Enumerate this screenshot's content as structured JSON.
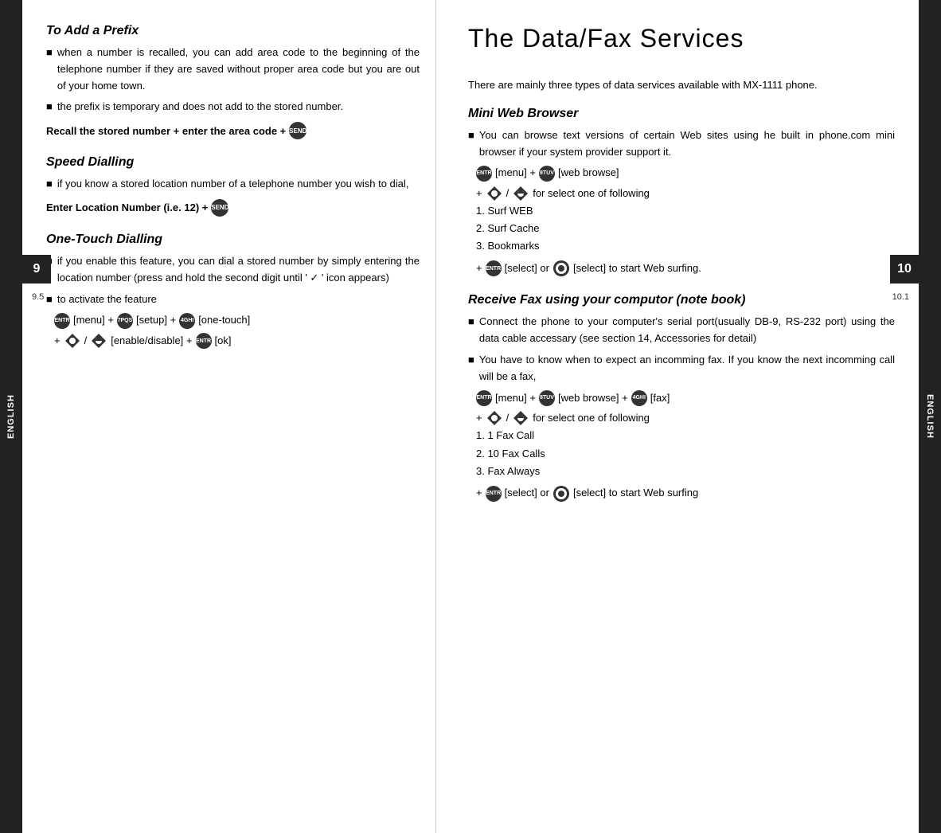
{
  "left_side_tab": "ENGLISH",
  "right_side_tab": "ENGLISH",
  "left_num_badge": "9",
  "right_num_badge": "10",
  "left_sub_badge": "9.5",
  "right_sub_badge": "10.1",
  "left_col": {
    "sections": [
      {
        "id": "add-prefix",
        "title": "To Add a Prefix",
        "bullets": [
          "when a number is recalled, you can add area code to the beginning of the telephone number if they are saved without proper area code but you are out of your home town.",
          "the prefix is temporary and does not add to the stored number."
        ],
        "instruction": "Recall the stored number + enter the area code +",
        "instruction_btn": "SEND"
      },
      {
        "id": "speed-dialling",
        "title": "Speed Dialling",
        "bullets": [
          "if you know a stored location number of a telephone number you wish to dial,"
        ],
        "instruction": "Enter Location Number (i.e. 12) +",
        "instruction_btn": "SEND"
      },
      {
        "id": "one-touch-dialling",
        "title": "One-Touch Dialling",
        "bullets": [
          "if you enable this feature, you can dial a stored number by simply entering the location number (press and hold the second digit until '✓' icon appears)",
          "to activate the feature"
        ],
        "steps": [
          {
            "text": "[menu] +",
            "btn1": "7PQS",
            "text2": "[setup] +",
            "btn2": "4GHI",
            "text3": "[one-touch]"
          },
          {
            "text": "+ ◆/▲  [enable/disable] +",
            "btn": "ENTER",
            "text2": "[ok]"
          }
        ]
      }
    ]
  },
  "right_col": {
    "page_title": "The Data/Fax Services",
    "intro": "There are mainly three types of data services available with MX-1111 phone.",
    "sections": [
      {
        "id": "mini-web-browser",
        "title": "Mini Web Browser",
        "bullets": [
          "You can browse text versions of certain Web sites using he built in phone.com mini browser if your system provider support it."
        ],
        "steps": [
          {
            "btn": "ENTER",
            "text": "[menu] +",
            "btn2": "8TUV",
            "text2": "[web browse]"
          },
          {
            "text": "+  ◆/▲   for select one of following"
          }
        ],
        "list_items": [
          "1. Surf WEB",
          "2. Surf Cache",
          "3. Bookmarks"
        ],
        "final_step": "+  [select] or    [select] to start Web surfing."
      },
      {
        "id": "receive-fax",
        "title": "Receive Fax using your computor (note book)",
        "bullets": [
          "Connect the phone to your computer's serial port(usually DB-9, RS-232 port) using the data cable accessary (see section 14, Accessories for detail)",
          "You have to know when to expect an incomming fax. If you know the next incomming call will be a fax,"
        ],
        "steps": [
          {
            "btn": "ENTER",
            "text": "[menu] +",
            "btn2": "8TUV",
            "text2": "[web browse] +",
            "btn3": "4GHI",
            "text3": "[fax]"
          },
          {
            "text": "+  ◆/▲   for select one of following"
          }
        ],
        "list_items": [
          "1. 1 Fax Call",
          "2. 10 Fax Calls",
          "3. Fax Always"
        ],
        "final_step": "+  [select] or    [select] to start Web surfing"
      }
    ]
  }
}
